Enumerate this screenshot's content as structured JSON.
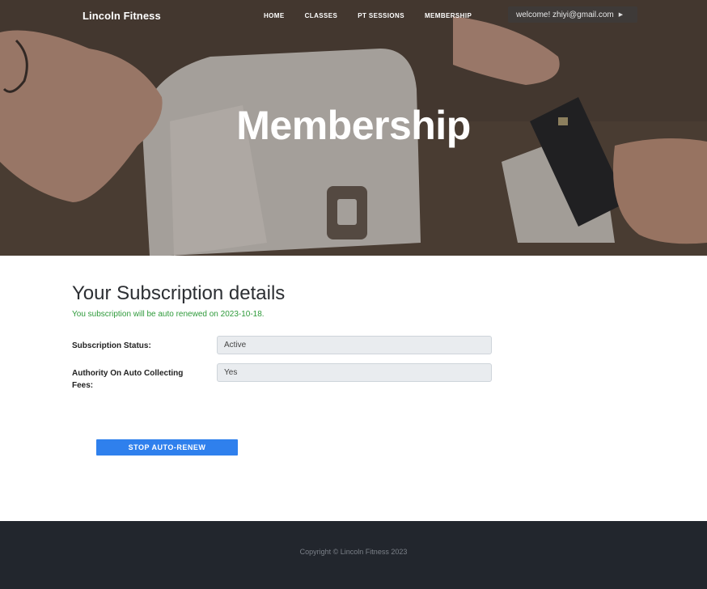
{
  "nav": {
    "brand": "Lincoln Fitness",
    "links": [
      "HOME",
      "CLASSES",
      "PT SESSIONS",
      "MEMBERSHIP"
    ],
    "user_label": "welcome! zhiyi@gmail.com"
  },
  "hero": {
    "title": "Membership"
  },
  "subscription": {
    "heading": "Your Subscription details",
    "renew_note": "You subscription will be auto renewed on 2023-10-18.",
    "status_label": "Subscription Status:",
    "status_value": "Active",
    "authority_label": "Authority On Auto Collecting Fees:",
    "authority_value": "Yes",
    "stop_button": "STOP AUTO-RENEW"
  },
  "footer": {
    "copyright": "Copyright © Lincoln Fitness 2023"
  },
  "colors": {
    "accent": "#2f80ed",
    "success_text": "#2e9a3a",
    "footer_bg": "#22262d"
  }
}
